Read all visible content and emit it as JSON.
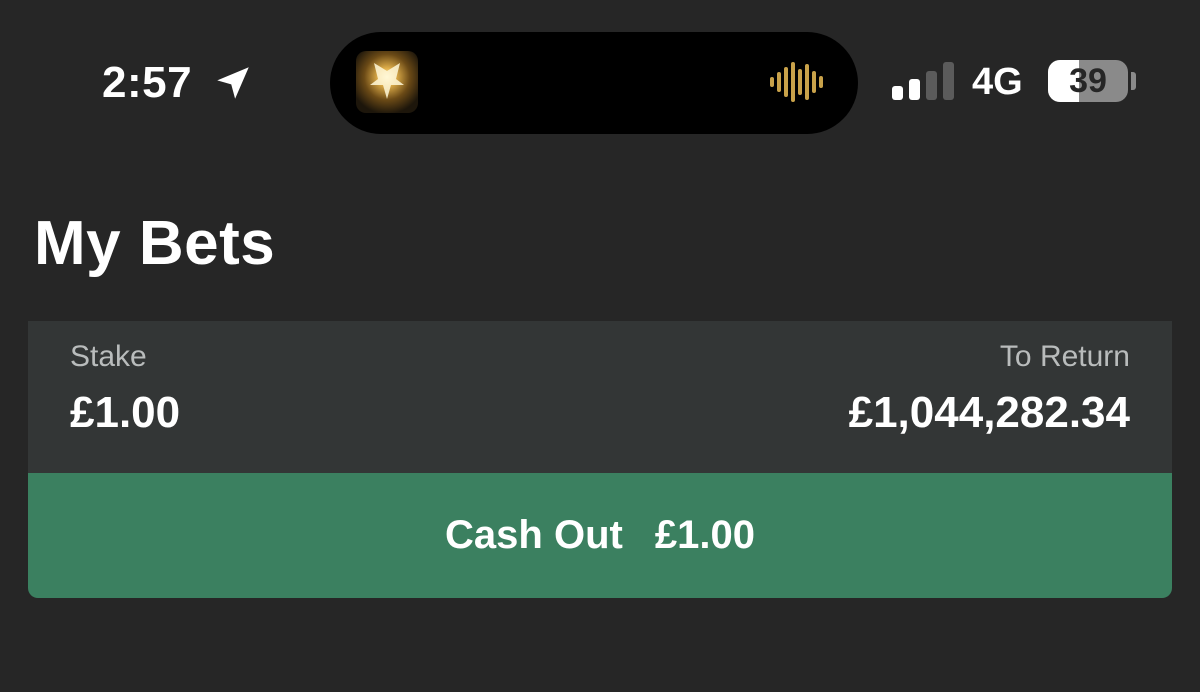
{
  "status_bar": {
    "time": "2:57",
    "network": "4G",
    "battery_level": "39",
    "battery_fraction": 0.39,
    "signal_bars_active": 2,
    "signal_bars_total": 4,
    "location_icon": "location-arrow-icon",
    "waveform_icon": "audio-waveform-icon"
  },
  "page": {
    "title": "My Bets"
  },
  "bet": {
    "stake_label": "Stake",
    "stake_value": "£1.00",
    "return_label": "To Return",
    "return_value": "£1,044,282.34"
  },
  "cashout": {
    "label": "Cash Out",
    "amount": "£1.00"
  },
  "colors": {
    "background": "#262626",
    "card": "#333636",
    "cashout_green": "#3b8060",
    "waveform_gold": "#c9a24a"
  }
}
